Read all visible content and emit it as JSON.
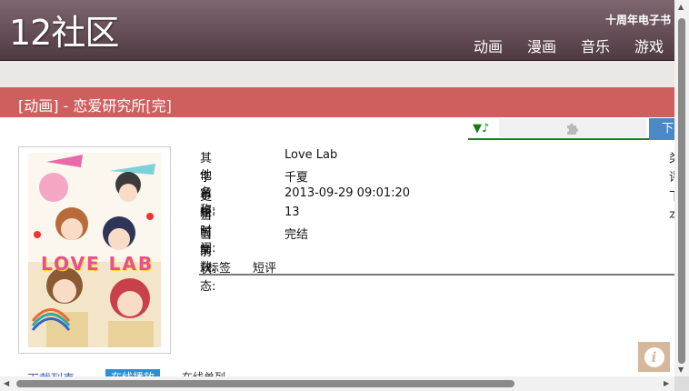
{
  "header": {
    "logo": "12社区",
    "ebook_link": "十周年电子书",
    "nav": [
      "动画",
      "漫画",
      "音乐",
      "游戏"
    ]
  },
  "title_bar": {
    "text": "[动画] - 恋爱研究所[完]"
  },
  "toolbar": {
    "music_icon": "▼♪",
    "download_label": "下"
  },
  "info": [
    {
      "label": "其他名称:",
      "value": "Love Lab"
    },
    {
      "label": "字幕组:",
      "value": "千夏"
    },
    {
      "label": "更新时间:",
      "value": "2013-09-29 09:01:20"
    },
    {
      "label": "当前集数:",
      "value": "13"
    },
    {
      "label": "当前状态:",
      "value": "完结"
    }
  ],
  "right_col": [
    "类",
    "评",
    "下",
    "本"
  ],
  "tabs": [
    "标签",
    "短评"
  ],
  "bottom": {
    "download_list": "下载列表",
    "active_tab": "在线播放",
    "tab3": "在线单列"
  },
  "cover_text": "LOVE LAB",
  "colors": {
    "header": "#6b5058",
    "title_bar": "#cf5e5f",
    "accent_green": "#1f7f1f",
    "download_blue": "#4a88c7"
  }
}
